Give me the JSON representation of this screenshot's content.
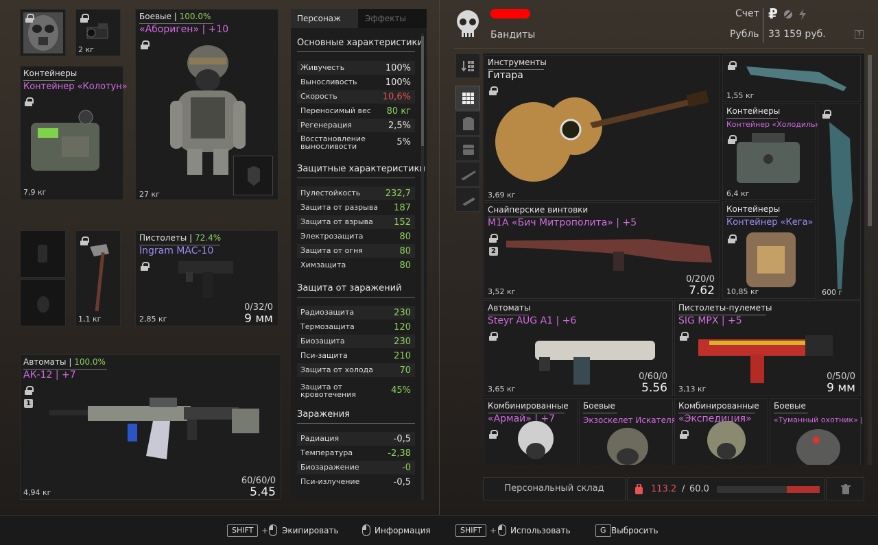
{
  "equipment": {
    "mask_slot": {
      "icon": "gas-mask-icon"
    },
    "device_slot": {
      "weight": "2 кг",
      "icon": "night-vision-icon"
    },
    "armor": {
      "category": "Боевые",
      "separator": "|",
      "condition": "100.0%",
      "name": "«Абориген» | +10",
      "weight": "27 кг",
      "icon": "armor-suit-icon"
    },
    "container": {
      "category": "Контейнеры",
      "name": "Контейнер «Колотун»",
      "weight": "7,9 кг",
      "icon": "container-icon"
    },
    "melee": {
      "weight": "1,1 кг",
      "icon": "axe-icon"
    },
    "pistol": {
      "category": "Пистолеты",
      "separator": "|",
      "condition": "72.4%",
      "name": "Ingram MAC-10",
      "weight": "2,85 кг",
      "ammo": "0/32/0",
      "caliber": "9 мм",
      "icon": "pistol-icon"
    },
    "rifle": {
      "category": "Автоматы",
      "separator": "|",
      "condition": "100.0%",
      "name": "АК-12 | +7",
      "weight": "4,94 кг",
      "ammo": "60/60/0",
      "caliber": "5.45",
      "badge": "1",
      "icon": "rifle-icon"
    }
  },
  "stats": {
    "tab_character": "Персонаж",
    "tab_effects": "Эффекты",
    "sections": [
      {
        "title": "Основные характеристики",
        "rows": [
          {
            "k": "Живучесть",
            "v": "100%",
            "c": "#e8e8e8"
          },
          {
            "k": "Выносливость",
            "v": "100%",
            "c": "#e8e8e8"
          },
          {
            "k": "Скорость",
            "v": "10,6%",
            "c": "#e55353"
          },
          {
            "k": "Переносимый вес",
            "v": "80 кг",
            "c": "#8fd25a"
          },
          {
            "k": "Регенерация",
            "v": "2,5%",
            "c": "#e8e8e8"
          },
          {
            "k": "Восстановление выносливости",
            "v": "5%",
            "c": "#e8e8e8",
            "tall": true
          }
        ]
      },
      {
        "title": "Защитные характеристики",
        "rows": [
          {
            "k": "Пулестойкость",
            "v": "232,7",
            "c": "#8fd25a"
          },
          {
            "k": "Защита от разрыва",
            "v": "187",
            "c": "#8fd25a"
          },
          {
            "k": "Защита от взрыва",
            "v": "152",
            "c": "#8fd25a"
          },
          {
            "k": "Электрозащита",
            "v": "80",
            "c": "#8fd25a"
          },
          {
            "k": "Защита от огня",
            "v": "80",
            "c": "#8fd25a"
          },
          {
            "k": "Химзащита",
            "v": "80",
            "c": "#8fd25a"
          }
        ]
      },
      {
        "title": "Защита от заражений",
        "rows": [
          {
            "k": "Радиозащита",
            "v": "230",
            "c": "#8fd25a"
          },
          {
            "k": "Термозащита",
            "v": "120",
            "c": "#8fd25a"
          },
          {
            "k": "Биозащита",
            "v": "230",
            "c": "#8fd25a"
          },
          {
            "k": "Пси-защита",
            "v": "210",
            "c": "#8fd25a"
          },
          {
            "k": "Защита от холода",
            "v": "70",
            "c": "#8fd25a"
          },
          {
            "k": "Защита от кровотечения",
            "v": "45%",
            "c": "#8fd25a",
            "tall": true
          }
        ]
      },
      {
        "title": "Заражения",
        "rows": [
          {
            "k": "Радиация",
            "v": "-0,5",
            "c": "#e8e8e8"
          },
          {
            "k": "Температура",
            "v": "-2,38",
            "c": "#8fd25a"
          },
          {
            "k": "Биозаражение",
            "v": "-0",
            "c": "#8fd25a"
          },
          {
            "k": "Пси-излучение",
            "v": "-0,5",
            "c": "#e8e8e8"
          }
        ]
      }
    ]
  },
  "header": {
    "faction": "Бандиты",
    "account_label": "Счет",
    "currency_label": "Рубль",
    "balance": "33 159 руб.",
    "help": "?",
    "icons": [
      "ruble-icon",
      "coin-icon",
      "bolt-icon"
    ]
  },
  "stash": {
    "guitar": {
      "category": "Инструменты",
      "name": "Гитара",
      "weight": "3,69 кг"
    },
    "knife1": {
      "weight": "1,55 кг"
    },
    "cont_cold": {
      "category": "Контейнеры",
      "name": "Контейнер «Холодильн...",
      "weight": "6,4 кг"
    },
    "blade": {
      "weight": "600 г"
    },
    "sniper": {
      "category": "Снайперские винтовки",
      "name": "M1A «Бич Митрополита» | +5",
      "weight": "3,52 кг",
      "ammo": "0/20/0",
      "caliber": "7.62",
      "badge": "2"
    },
    "cont_keg": {
      "category": "Контейнеры",
      "name": "Контейнер «Кега»",
      "weight": "10,85 кг"
    },
    "aug": {
      "category": "Автоматы",
      "name": "Steyr AUG A1 | +6",
      "weight": "3,65 кг",
      "ammo": "0/60/0",
      "caliber": "5.56"
    },
    "mpx": {
      "category": "Пистолеты-пулеметы",
      "name": "SIG MPX | +5",
      "weight": "3,13 кг",
      "ammo": "0/50/0",
      "caliber": "9 мм"
    },
    "armor1": {
      "category": "Комбинированные",
      "name": "«Армай» | +7"
    },
    "armor2": {
      "category": "Боевые",
      "name": "Экзоскелет Искателя"
    },
    "armor3": {
      "category": "Комбинированные",
      "name": "«Экспедиция»"
    },
    "armor4": {
      "category": "Боевые",
      "name": "«Туманный охотник» | +"
    }
  },
  "footer": {
    "stash_button": "Персональный склад",
    "weight_current": "113.2",
    "weight_sep": "/",
    "weight_max": "60.0",
    "weight_fill": 1.0
  },
  "hints": {
    "shift": "SHIFT",
    "plus": "+",
    "equip": "Экипировать",
    "info": "Информация",
    "use": "Использовать",
    "g": "G",
    "drop": "Выбросить"
  }
}
